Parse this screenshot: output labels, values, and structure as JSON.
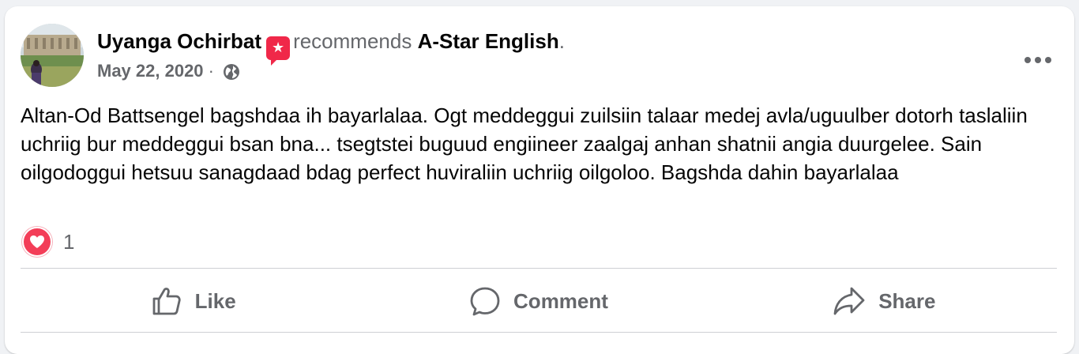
{
  "post": {
    "author_name": "Uyanga Ochirbat",
    "recommend_badge_icon": "recommend-star-icon",
    "recommends_text": "recommends",
    "page_name": "A-Star English",
    "period": ".",
    "date": "May 22, 2020",
    "separator": "·",
    "privacy_icon": "globe-icon",
    "more_icon": "more-options-icon",
    "body": "Altan-Od Battsengel bagshdaa ih bayarlalaa. Ogt meddeggui zuilsiin talaar medej avla/uguulber dotorh taslaliin uchriig bur meddeggui bsan bna... tsegtstei buguud engiineer zaalgaj anhan shatnii angia duurgelee. Sain oilgodoggui hetsuu sanagdaad bdag perfect huviraliin uchriig oilgoloo. Bagshda dahin bayarlalaa"
  },
  "reactions": {
    "icon": "love-reaction-icon",
    "count": "1"
  },
  "actions": {
    "like_label": "Like",
    "comment_label": "Comment",
    "share_label": "Share"
  },
  "colors": {
    "text_primary": "#050505",
    "text_secondary": "#65676b",
    "love_red": "#f33e58",
    "recommend_red": "#f02849",
    "divider": "#ced0d4",
    "background": "#f0f2f5"
  }
}
